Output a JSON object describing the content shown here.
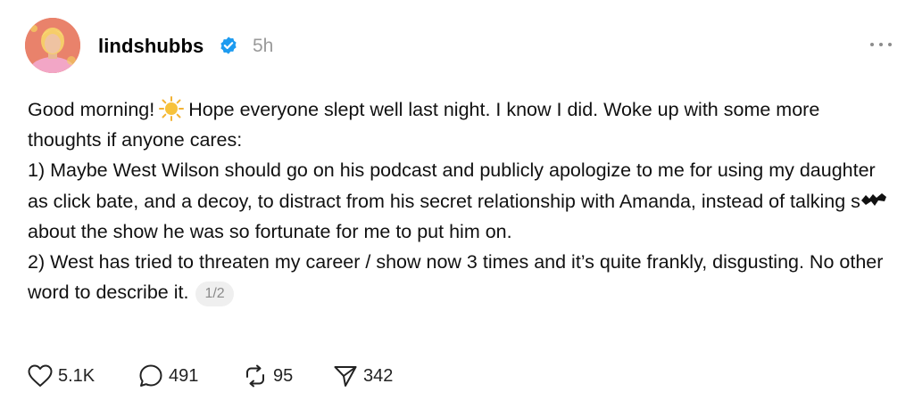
{
  "post": {
    "username": "lindshubbs",
    "timestamp": "5h",
    "body": {
      "line1_before_sun": "Good morning!",
      "line1_after_sun": "Hope everyone slept well last night. I know I did. Woke up with some more thoughts if anyone cares:",
      "point1_before_censor": "1) Maybe West Wilson should go on his podcast and publicly apologize to me for using my daughter as click bate, and a decoy, to distract from his secret relationship with Amanda, instead of talking s",
      "point1_after_censor": "about the show he was so fortunate for me to put him on.",
      "point2": "2) West has tried to threaten my career / show now 3 times and it’s quite frankly, disgusting. No other word to describe it."
    },
    "page_indicator": "1/2"
  },
  "actions": {
    "likes": "5.1K",
    "replies": "491",
    "reposts": "95",
    "shares": "342"
  },
  "icons": {
    "verified": "verified-badge-icon",
    "sun": "sun-emoji-icon",
    "more": "more-options-icon",
    "like": "heart-icon",
    "reply": "comment-bubble-icon",
    "repost": "repost-icon",
    "share": "send-icon"
  },
  "colors": {
    "verified_blue": "#1d9bf0",
    "muted_gray": "#9a9a9a"
  }
}
